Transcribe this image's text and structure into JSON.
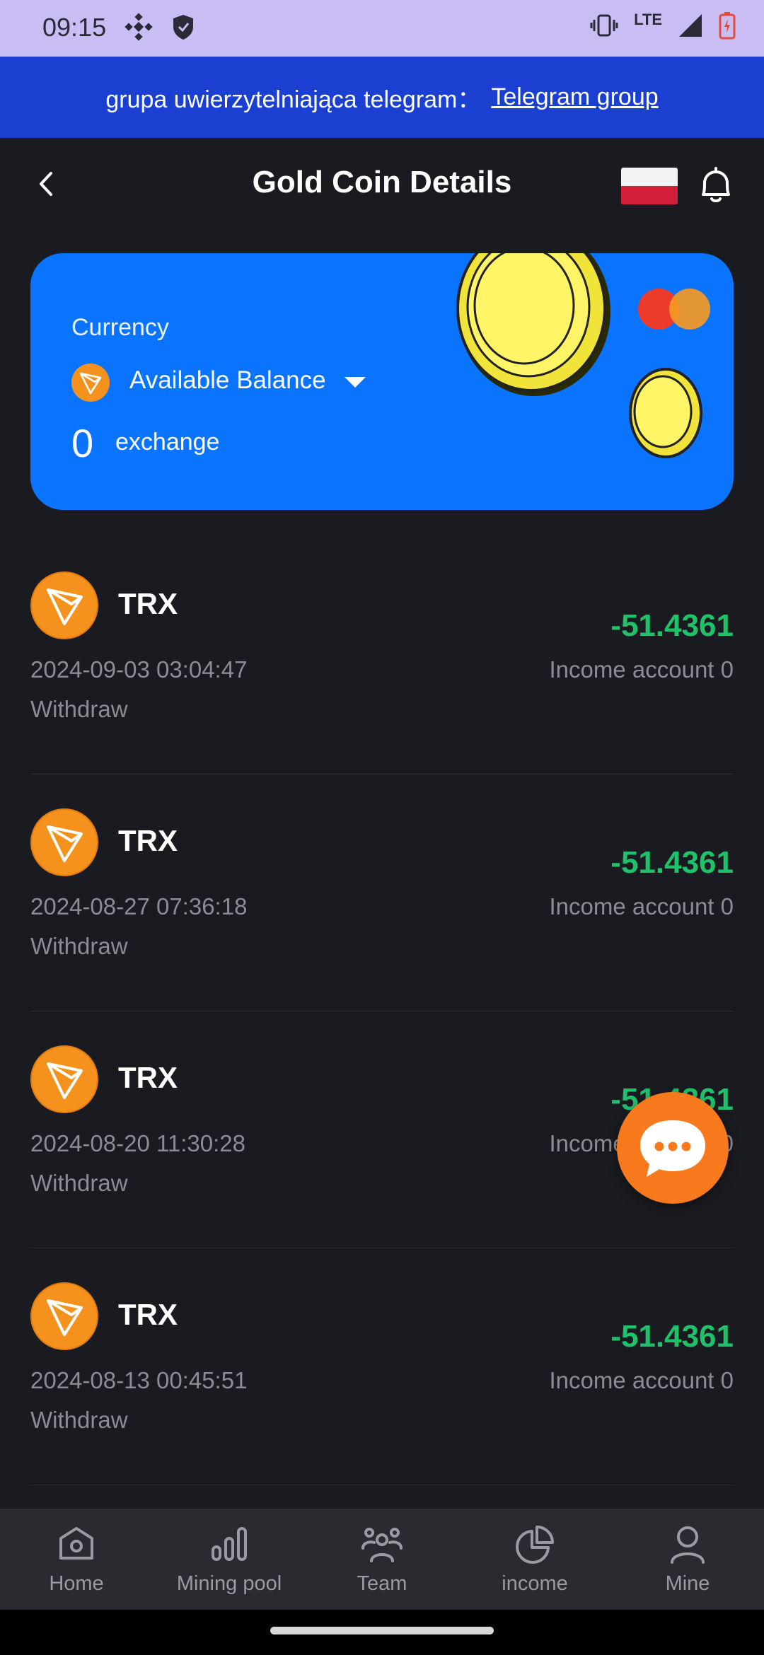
{
  "status_bar": {
    "time": "09:15",
    "network": "LTE"
  },
  "banner": {
    "text": "grupa uwierzytelniająca telegram：",
    "link_text": "Telegram group"
  },
  "header": {
    "title": "Gold Coin Details"
  },
  "card": {
    "currency_label": "Currency",
    "balance_label": "Available Balance",
    "amount": "0",
    "exchange_label": "exchange"
  },
  "transactions": [
    {
      "symbol": "TRX",
      "date": "2024-09-03 03:04:47",
      "type": "Withdraw",
      "amount": "-51.4361",
      "account": "Income account 0"
    },
    {
      "symbol": "TRX",
      "date": "2024-08-27 07:36:18",
      "type": "Withdraw",
      "amount": "-51.4361",
      "account": "Income account 0"
    },
    {
      "symbol": "TRX",
      "date": "2024-08-20 11:30:28",
      "type": "Withdraw",
      "amount": "-51.4361",
      "account": "Income account 0"
    },
    {
      "symbol": "TRX",
      "date": "2024-08-13 00:45:51",
      "type": "Withdraw",
      "amount": "-51.4361",
      "account": "Income account 0"
    }
  ],
  "bottom_nav": [
    {
      "label": "Home",
      "icon": "home-icon"
    },
    {
      "label": "Mining pool",
      "icon": "bar-chart-icon"
    },
    {
      "label": "Team",
      "icon": "team-icon"
    },
    {
      "label": "income",
      "icon": "pie-chart-icon"
    },
    {
      "label": "Mine",
      "icon": "user-icon"
    }
  ],
  "colors": {
    "background": "#1a1b20",
    "banner": "#1a3fd1",
    "card": "#0a74ff",
    "positive_amount": "#1fc16b",
    "accent_orange": "#f87a1c"
  }
}
